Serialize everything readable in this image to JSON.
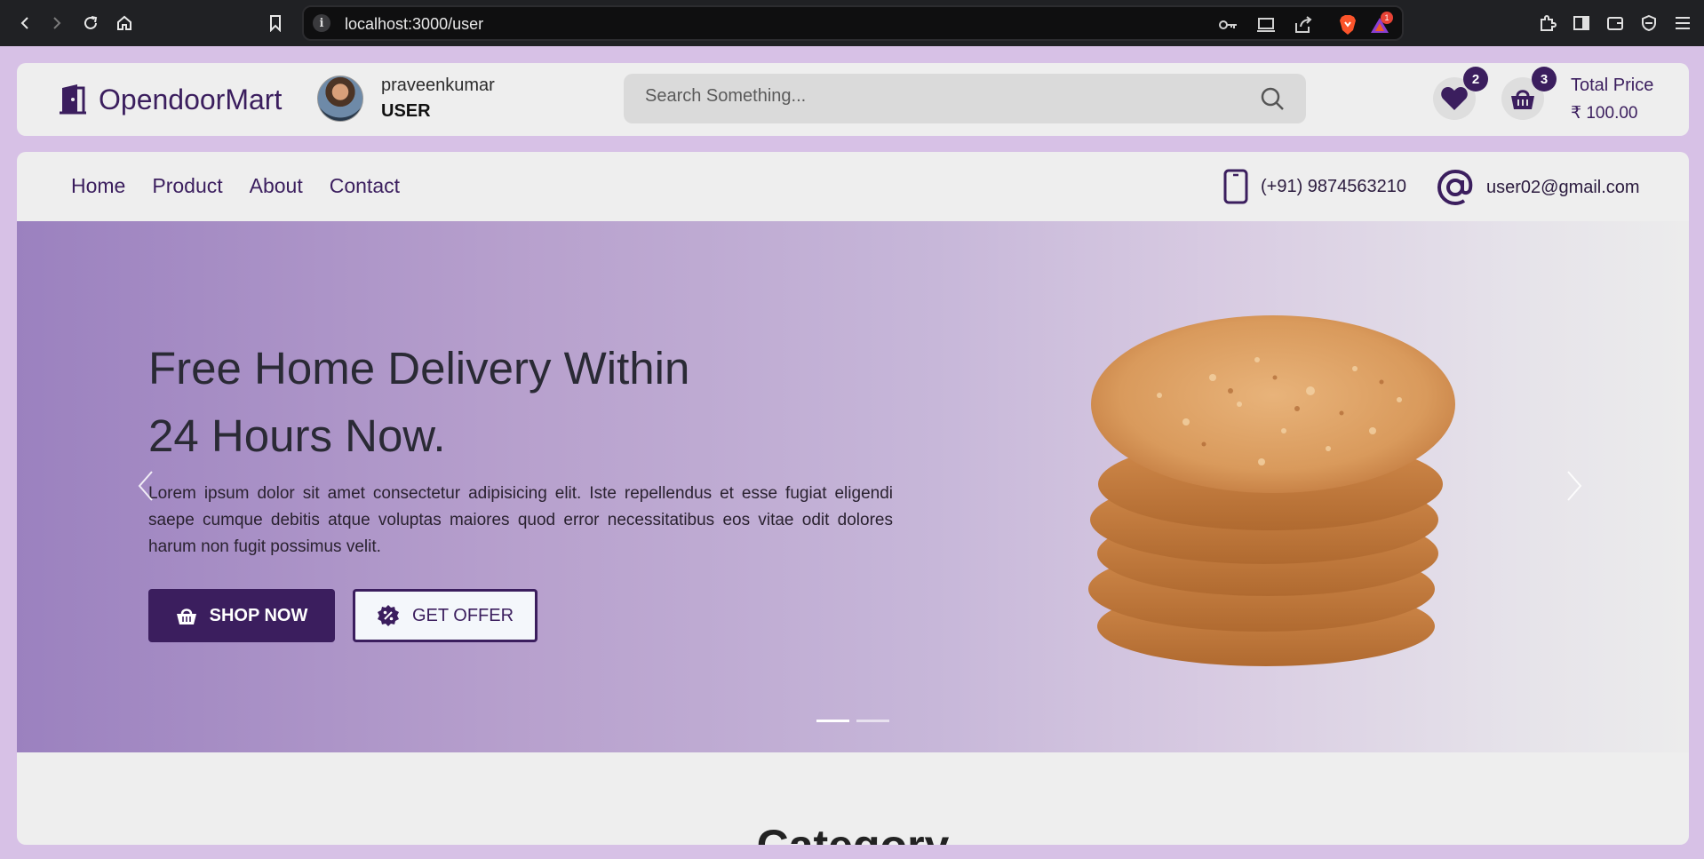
{
  "browser": {
    "url": "localhost:3000/user",
    "info_glyph": "i",
    "brave_badge_count": "1"
  },
  "header": {
    "brand": "OpendoorMart",
    "user_name": "praveenkumar",
    "user_role": "USER",
    "search_placeholder": "Search Something...",
    "wishlist_count": "2",
    "cart_count": "3",
    "total_label": "Total Price",
    "total_amount": "₹ 100.00"
  },
  "nav": {
    "items": [
      "Home",
      "Product",
      "About",
      "Contact"
    ],
    "phone": "(+91) 9874563210",
    "email": "user02@gmail.com"
  },
  "hero": {
    "title_line1": "Free Home Delivery Within",
    "title_line2": "24 Hours Now.",
    "text": "Lorem ipsum dolor sit amet consectetur adipisicing elit. Iste repellendus et esse fugiat eligendi saepe cumque debitis atque voluptas maiores quod error necessitatibus eos vitae odit dolores harum non fugit possimus velit.",
    "shop_button": "SHOP NOW",
    "offer_button": "GET OFFER",
    "slide_count": 2,
    "active_slide": 1
  },
  "section": {
    "category_title": "Category"
  },
  "colors": {
    "brand_purple": "#3b1e5e",
    "page_bg": "#d7c1e6",
    "card_bg": "#eeeeee"
  },
  "icons": [
    "back-icon",
    "forward-icon",
    "reload-icon",
    "home-icon",
    "bookmark-icon",
    "key-icon",
    "cast-icon",
    "share-icon",
    "brave-icon",
    "brave-rewards-icon",
    "extensions-icon",
    "sidebar-icon",
    "wallet-icon",
    "vpn-icon",
    "menu-icon",
    "door-icon",
    "search-icon",
    "heart-icon",
    "basket-icon",
    "phone-icon",
    "at-icon",
    "percent-badge-icon",
    "chevron-left-icon",
    "chevron-right-icon"
  ]
}
